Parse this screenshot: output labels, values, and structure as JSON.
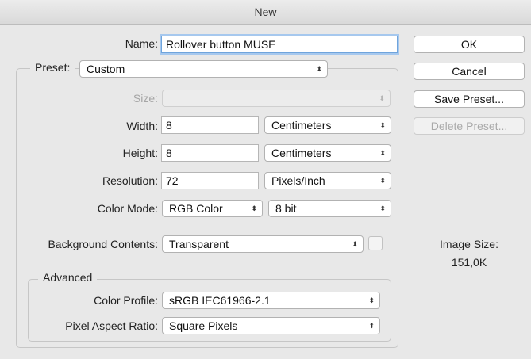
{
  "window": {
    "title": "New"
  },
  "fields": {
    "name_label": "Name:",
    "name_value": "Rollover button MUSE",
    "preset_label": "Preset:",
    "preset_value": "Custom",
    "size_label": "Size:",
    "size_value": "",
    "width_label": "Width:",
    "width_value": "8",
    "width_unit": "Centimeters",
    "height_label": "Height:",
    "height_value": "8",
    "height_unit": "Centimeters",
    "resolution_label": "Resolution:",
    "resolution_value": "72",
    "resolution_unit": "Pixels/Inch",
    "color_mode_label": "Color Mode:",
    "color_mode_value": "RGB Color",
    "bit_depth_value": "8 bit",
    "background_label": "Background Contents:",
    "background_value": "Transparent"
  },
  "advanced": {
    "title": "Advanced",
    "color_profile_label": "Color Profile:",
    "color_profile_value": "sRGB IEC61966-2.1",
    "pixel_aspect_label": "Pixel Aspect Ratio:",
    "pixel_aspect_value": "Square Pixels"
  },
  "buttons": {
    "ok": "OK",
    "cancel": "Cancel",
    "save_preset": "Save Preset...",
    "delete_preset": "Delete Preset..."
  },
  "image_size": {
    "label": "Image Size:",
    "value": "151,0K"
  },
  "icons": {
    "dropdown": "up-down-chevron-icon"
  },
  "colors": {
    "focus_ring": "#a6c8ee",
    "window_bg": "#e8e8e8"
  }
}
